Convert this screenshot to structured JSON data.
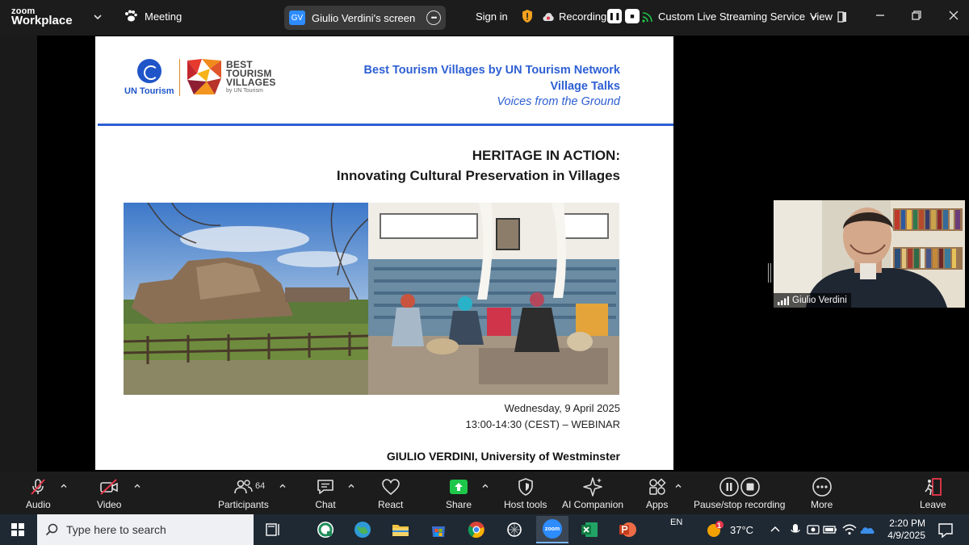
{
  "topbar": {
    "brand_line1": "zoom",
    "brand_line2": "Workplace",
    "meeting_label": "Meeting",
    "screen_badge": "GV",
    "screen_label": "Giulio Verdini's screen",
    "sign_in": "Sign in",
    "recording_label": "Recording...",
    "stream_label": "Custom Live Streaming Service",
    "view_label": "View"
  },
  "slide": {
    "un_logo_text": "UN Tourism",
    "btv_logo_line1": "BEST",
    "btv_logo_line2": "TOURISM",
    "btv_logo_line3": "VILLAGES",
    "btv_logo_sub": "by UN Tourism",
    "header_line1": "Best Tourism Villages by UN Tourism Network",
    "header_line2": "Village Talks",
    "header_line3": "Voices from the Ground",
    "title_line1": "HERITAGE IN ACTION:",
    "title_line2": "Innovating Cultural Preservation in Villages",
    "date": "Wednesday, 9 April 2025",
    "time": "13:00-14:30 (CEST) – WEBINAR",
    "speaker": "GIULIO VERDINI,  University of Westminster"
  },
  "video": {
    "participant_name": "Giulio Verdini"
  },
  "toolbar": {
    "audio": "Audio",
    "video": "Video",
    "participants": "Participants",
    "participants_count": "64",
    "chat": "Chat",
    "react": "React",
    "share": "Share",
    "host_tools": "Host tools",
    "ai_companion": "AI Companion",
    "apps": "Apps",
    "pause_recording": "Pause/stop recording",
    "more": "More",
    "leave": "Leave"
  },
  "taskbar": {
    "search_placeholder": "Type here to search",
    "language": "EN",
    "weather_temp": "37°C",
    "weather_badge": "1",
    "time": "2:20 PM",
    "date": "4/9/2025",
    "zoom_label": "zoom"
  },
  "colors": {
    "zoom_blue": "#2d8cff",
    "share_green": "#1ec74a",
    "slide_blue": "#2d5fd3",
    "leave_red": "#e8374b"
  }
}
